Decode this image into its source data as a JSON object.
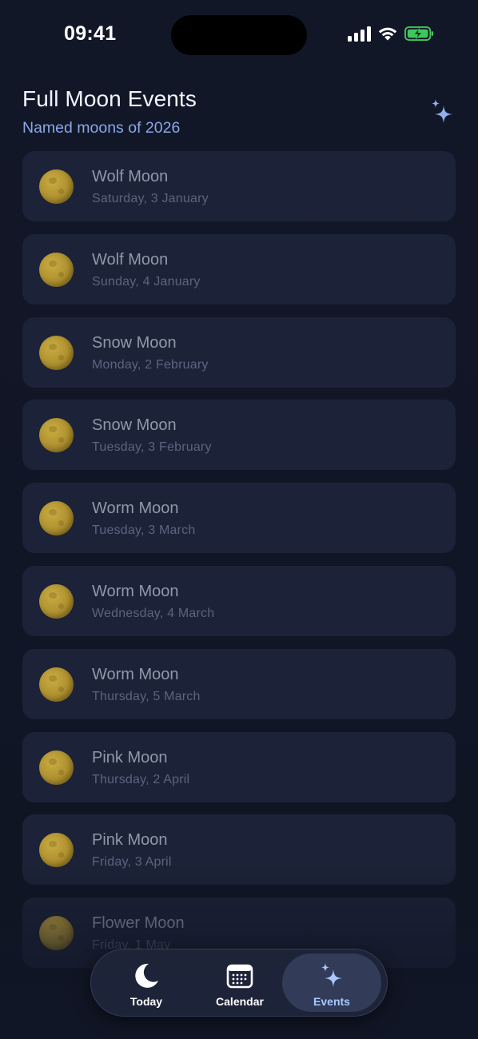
{
  "status_bar": {
    "time": "09:41"
  },
  "header": {
    "title": "Full Moon Events",
    "subtitle": "Named moons of 2026",
    "action_icon": "sparkles-icon"
  },
  "events": [
    {
      "name": "Wolf Moon",
      "date": "Saturday, 3 January"
    },
    {
      "name": "Wolf Moon",
      "date": "Sunday, 4 January"
    },
    {
      "name": "Snow Moon",
      "date": "Monday, 2 February"
    },
    {
      "name": "Snow Moon",
      "date": "Tuesday, 3 February"
    },
    {
      "name": "Worm Moon",
      "date": "Tuesday, 3 March"
    },
    {
      "name": "Worm Moon",
      "date": "Wednesday, 4 March"
    },
    {
      "name": "Worm Moon",
      "date": "Thursday, 5 March"
    },
    {
      "name": "Pink Moon",
      "date": "Thursday, 2 April"
    },
    {
      "name": "Pink Moon",
      "date": "Friday, 3 April"
    },
    {
      "name": "Flower Moon",
      "date": "Friday, 1 May"
    }
  ],
  "tab_bar": {
    "tabs": [
      {
        "label": "Today",
        "icon": "moon-icon",
        "active": false
      },
      {
        "label": "Calendar",
        "icon": "calendar-icon",
        "active": false
      },
      {
        "label": "Events",
        "icon": "sparkles-icon",
        "active": true
      }
    ]
  },
  "colors": {
    "background": "#111726",
    "card": "#1c2237",
    "accent": "#8aa7e6",
    "moon": "#b39532",
    "active_tab": "#323c58"
  }
}
